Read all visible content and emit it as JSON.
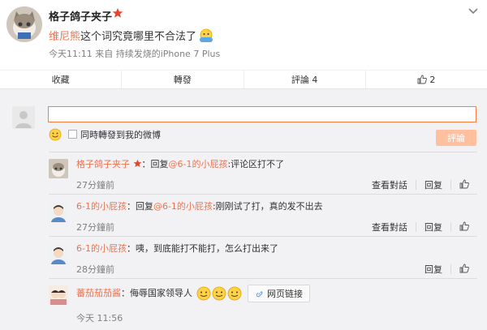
{
  "post": {
    "author": "格子鸽子夹子",
    "mention": "维尼熊",
    "text": "这个词究竟哪里不合法了",
    "time": "今天11:11",
    "source": "来自 持续发烧的iPhone 7 Plus"
  },
  "actions": {
    "collect": "收藏",
    "forward": "轉發",
    "comment": "評論 4",
    "like": "2"
  },
  "composer": {
    "input_value": "",
    "forward_label": "同時轉發到我的微博",
    "submit_label": "評論"
  },
  "comments": [
    {
      "name": "格子鸽子夹子",
      "reply_prefix": "：回复",
      "reply_to": "@6-1的小屁孩",
      "text": ":评论区打不了",
      "time": "27分鐘前",
      "report": "查看對話",
      "reply": "回复"
    },
    {
      "name": "6-1的小屁孩",
      "reply_prefix": "：回复",
      "reply_to": "@6-1的小屁孩",
      "text": ":刚刚试了打，真的发不出去",
      "time": "27分鐘前",
      "report": "查看對話",
      "reply": "回复"
    },
    {
      "name": "6-1的小屁孩",
      "reply_prefix": "",
      "reply_to": "",
      "text": "：咦，到底能打不能打，怎么打出来了",
      "time": "28分鐘前",
      "report": "",
      "reply": "回复"
    },
    {
      "name": "蕃茄茄茄酱",
      "reply_prefix": "",
      "reply_to": "",
      "text": "：侮辱国家领导人",
      "time": "今天 11:56",
      "link_label": "网页链接",
      "report": "",
      "reply": ""
    }
  ],
  "colors": {
    "accent": "#eb7350",
    "input_border": "#fa7d3c",
    "submit_bg": "#ffc09f",
    "vip_star": "#e6432d"
  },
  "icons": [
    "vip-star-icon",
    "chevron-down-icon",
    "thumb-up-icon",
    "smiley-icon",
    "link-icon",
    "emoji-face-icon"
  ]
}
